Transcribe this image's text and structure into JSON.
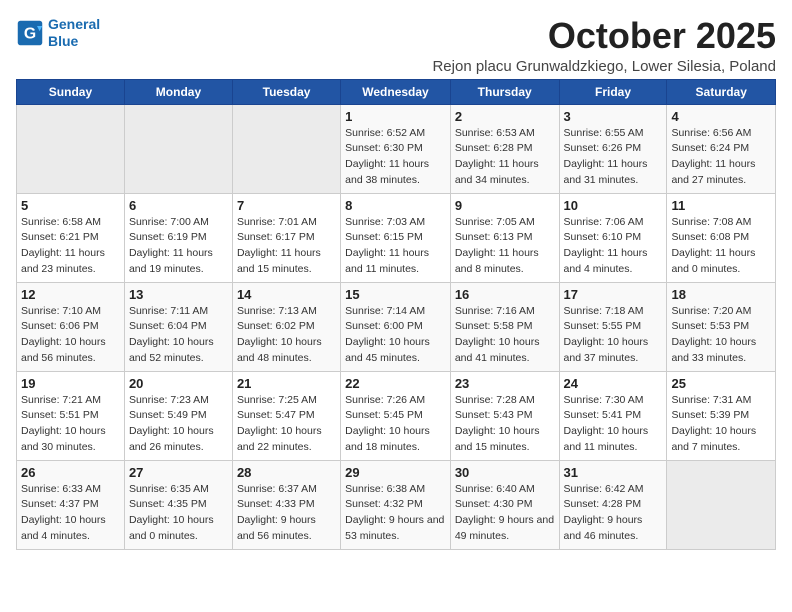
{
  "header": {
    "logo_line1": "General",
    "logo_line2": "Blue",
    "month_title": "October 2025",
    "subtitle": "Rejon placu Grunwaldzkiego, Lower Silesia, Poland"
  },
  "weekdays": [
    "Sunday",
    "Monday",
    "Tuesday",
    "Wednesday",
    "Thursday",
    "Friday",
    "Saturday"
  ],
  "weeks": [
    [
      {
        "day": "",
        "info": ""
      },
      {
        "day": "",
        "info": ""
      },
      {
        "day": "",
        "info": ""
      },
      {
        "day": "1",
        "info": "Sunrise: 6:52 AM\nSunset: 6:30 PM\nDaylight: 11 hours and 38 minutes."
      },
      {
        "day": "2",
        "info": "Sunrise: 6:53 AM\nSunset: 6:28 PM\nDaylight: 11 hours and 34 minutes."
      },
      {
        "day": "3",
        "info": "Sunrise: 6:55 AM\nSunset: 6:26 PM\nDaylight: 11 hours and 31 minutes."
      },
      {
        "day": "4",
        "info": "Sunrise: 6:56 AM\nSunset: 6:24 PM\nDaylight: 11 hours and 27 minutes."
      }
    ],
    [
      {
        "day": "5",
        "info": "Sunrise: 6:58 AM\nSunset: 6:21 PM\nDaylight: 11 hours and 23 minutes."
      },
      {
        "day": "6",
        "info": "Sunrise: 7:00 AM\nSunset: 6:19 PM\nDaylight: 11 hours and 19 minutes."
      },
      {
        "day": "7",
        "info": "Sunrise: 7:01 AM\nSunset: 6:17 PM\nDaylight: 11 hours and 15 minutes."
      },
      {
        "day": "8",
        "info": "Sunrise: 7:03 AM\nSunset: 6:15 PM\nDaylight: 11 hours and 11 minutes."
      },
      {
        "day": "9",
        "info": "Sunrise: 7:05 AM\nSunset: 6:13 PM\nDaylight: 11 hours and 8 minutes."
      },
      {
        "day": "10",
        "info": "Sunrise: 7:06 AM\nSunset: 6:10 PM\nDaylight: 11 hours and 4 minutes."
      },
      {
        "day": "11",
        "info": "Sunrise: 7:08 AM\nSunset: 6:08 PM\nDaylight: 11 hours and 0 minutes."
      }
    ],
    [
      {
        "day": "12",
        "info": "Sunrise: 7:10 AM\nSunset: 6:06 PM\nDaylight: 10 hours and 56 minutes."
      },
      {
        "day": "13",
        "info": "Sunrise: 7:11 AM\nSunset: 6:04 PM\nDaylight: 10 hours and 52 minutes."
      },
      {
        "day": "14",
        "info": "Sunrise: 7:13 AM\nSunset: 6:02 PM\nDaylight: 10 hours and 48 minutes."
      },
      {
        "day": "15",
        "info": "Sunrise: 7:14 AM\nSunset: 6:00 PM\nDaylight: 10 hours and 45 minutes."
      },
      {
        "day": "16",
        "info": "Sunrise: 7:16 AM\nSunset: 5:58 PM\nDaylight: 10 hours and 41 minutes."
      },
      {
        "day": "17",
        "info": "Sunrise: 7:18 AM\nSunset: 5:55 PM\nDaylight: 10 hours and 37 minutes."
      },
      {
        "day": "18",
        "info": "Sunrise: 7:20 AM\nSunset: 5:53 PM\nDaylight: 10 hours and 33 minutes."
      }
    ],
    [
      {
        "day": "19",
        "info": "Sunrise: 7:21 AM\nSunset: 5:51 PM\nDaylight: 10 hours and 30 minutes."
      },
      {
        "day": "20",
        "info": "Sunrise: 7:23 AM\nSunset: 5:49 PM\nDaylight: 10 hours and 26 minutes."
      },
      {
        "day": "21",
        "info": "Sunrise: 7:25 AM\nSunset: 5:47 PM\nDaylight: 10 hours and 22 minutes."
      },
      {
        "day": "22",
        "info": "Sunrise: 7:26 AM\nSunset: 5:45 PM\nDaylight: 10 hours and 18 minutes."
      },
      {
        "day": "23",
        "info": "Sunrise: 7:28 AM\nSunset: 5:43 PM\nDaylight: 10 hours and 15 minutes."
      },
      {
        "day": "24",
        "info": "Sunrise: 7:30 AM\nSunset: 5:41 PM\nDaylight: 10 hours and 11 minutes."
      },
      {
        "day": "25",
        "info": "Sunrise: 7:31 AM\nSunset: 5:39 PM\nDaylight: 10 hours and 7 minutes."
      }
    ],
    [
      {
        "day": "26",
        "info": "Sunrise: 6:33 AM\nSunset: 4:37 PM\nDaylight: 10 hours and 4 minutes."
      },
      {
        "day": "27",
        "info": "Sunrise: 6:35 AM\nSunset: 4:35 PM\nDaylight: 10 hours and 0 minutes."
      },
      {
        "day": "28",
        "info": "Sunrise: 6:37 AM\nSunset: 4:33 PM\nDaylight: 9 hours and 56 minutes."
      },
      {
        "day": "29",
        "info": "Sunrise: 6:38 AM\nSunset: 4:32 PM\nDaylight: 9 hours and 53 minutes."
      },
      {
        "day": "30",
        "info": "Sunrise: 6:40 AM\nSunset: 4:30 PM\nDaylight: 9 hours and 49 minutes."
      },
      {
        "day": "31",
        "info": "Sunrise: 6:42 AM\nSunset: 4:28 PM\nDaylight: 9 hours and 46 minutes."
      },
      {
        "day": "",
        "info": ""
      }
    ]
  ]
}
